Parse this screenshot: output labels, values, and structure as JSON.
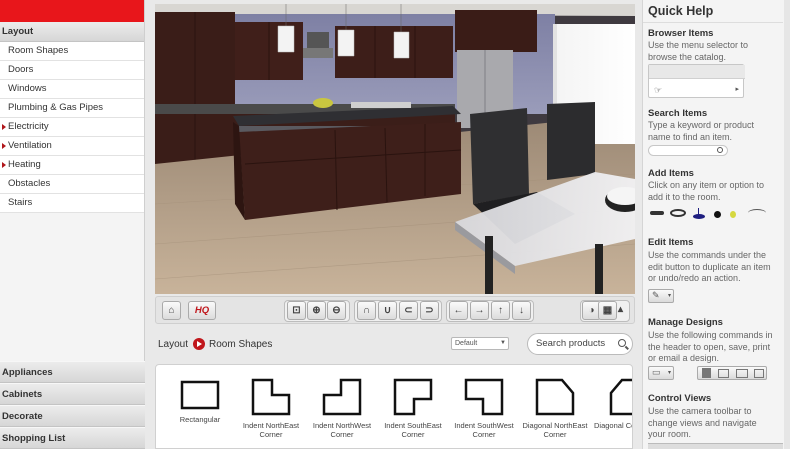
{
  "sidebar": {
    "section_title": "Layout",
    "items": [
      {
        "label": "Room Shapes",
        "has_sub": false
      },
      {
        "label": "Doors",
        "has_sub": false
      },
      {
        "label": "Windows",
        "has_sub": false
      },
      {
        "label": "Plumbing & Gas Pipes",
        "has_sub": false
      },
      {
        "label": "Electricity",
        "has_sub": true
      },
      {
        "label": "Ventilation",
        "has_sub": true
      },
      {
        "label": "Heating",
        "has_sub": true
      },
      {
        "label": "Obstacles",
        "has_sub": false
      },
      {
        "label": "Stairs",
        "has_sub": false
      }
    ],
    "bottom_sections": [
      "Appliances",
      "Cabinets",
      "Decorate",
      "Shopping List"
    ]
  },
  "toolbar": {
    "hq_label": "HQ"
  },
  "catalog": {
    "breadcrumb_root": "Layout",
    "breadcrumb_current": "Room Shapes",
    "sort_value": "Default",
    "search_placeholder": "Search products",
    "shapes": [
      {
        "label": "Rectangular"
      },
      {
        "label": "Indent NorthEast Corner"
      },
      {
        "label": "Indent NorthWest Corner"
      },
      {
        "label": "Indent SouthEast Corner"
      },
      {
        "label": "Indent SouthWest Corner"
      },
      {
        "label": "Diagonal NorthEast Corner"
      },
      {
        "label": "Diagonal Co"
      }
    ]
  },
  "help": {
    "title": "Quick Help",
    "sections": [
      {
        "heading": "Browser Items",
        "text": "Use the menu selector to browse the catalog."
      },
      {
        "heading": "Search Items",
        "text": "Type a keyword or product name to find an item."
      },
      {
        "heading": "Add Items",
        "text": "Click on any item or option to add it to the room."
      },
      {
        "heading": "Edit Items",
        "text": "Use the commands under the edit button to duplicate an item or undo/redo an action."
      },
      {
        "heading": "Manage Designs",
        "text": "Use the following commands in the header to open, save, print or email a design."
      },
      {
        "heading": "Control Views",
        "text": "Use the camera toolbar to change views and navigate your room."
      }
    ]
  },
  "colors": {
    "brand_red": "#e8161b",
    "arrow_red": "#c0161b",
    "cabinet": "#3b1f1a",
    "floor": "#b59c80",
    "wall": "#8d8fb0"
  },
  "icons": [
    "home-icon",
    "zoom-fit-icon",
    "zoom-in-icon",
    "zoom-out-icon",
    "orbit-up-icon",
    "orbit-down-icon",
    "rotate-left-icon",
    "rotate-right-icon",
    "arrow-left-icon",
    "arrow-right-icon",
    "arrow-up-icon",
    "arrow-down-icon",
    "view-3d-icon",
    "grid-icon",
    "search-icon"
  ]
}
